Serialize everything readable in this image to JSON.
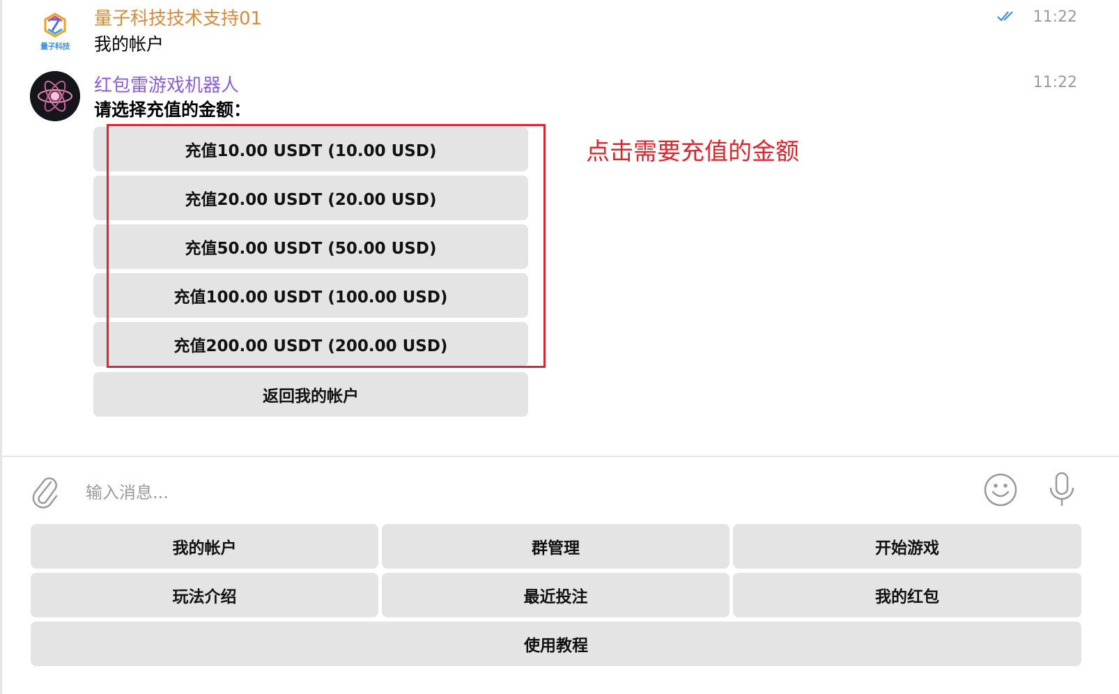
{
  "messages": [
    {
      "sender": "量子科技技术支持01",
      "avatar_logo_text": "量子科技",
      "text": "我的帐户",
      "time": "11:22",
      "read_status_icon": "double-check-icon"
    },
    {
      "sender": "红包雷游戏机器人",
      "text": "请选择充值的金额：",
      "time": "11:22"
    }
  ],
  "inline_keyboard": [
    {
      "label": "充值10.00 USDT (10.00 USD)"
    },
    {
      "label": "充值20.00 USDT (20.00 USD)"
    },
    {
      "label": "充值50.00 USDT (50.00 USD)"
    },
    {
      "label": "充值100.00 USDT (100.00 USD)"
    },
    {
      "label": "充值200.00 USDT (200.00 USD)"
    },
    {
      "label": "返回我的帐户"
    }
  ],
  "annotation": {
    "text": "点击需要充值的金额",
    "color": "#e0242e"
  },
  "composer": {
    "placeholder": "输入消息...",
    "attach_icon": "paperclip-icon",
    "emoji_icon": "smiley-icon",
    "mic_icon": "microphone-icon"
  },
  "reply_keyboard": [
    {
      "label": "我的帐户"
    },
    {
      "label": "群管理"
    },
    {
      "label": "开始游戏"
    },
    {
      "label": "玩法介绍"
    },
    {
      "label": "最近投注"
    },
    {
      "label": "我的红包"
    },
    {
      "label": "使用教程"
    }
  ],
  "colors": {
    "sender_1": "#d98a3a",
    "sender_2": "#8b5ed9",
    "button_bg": "#e4e4e4",
    "check_blue": "#3f8fe0"
  }
}
